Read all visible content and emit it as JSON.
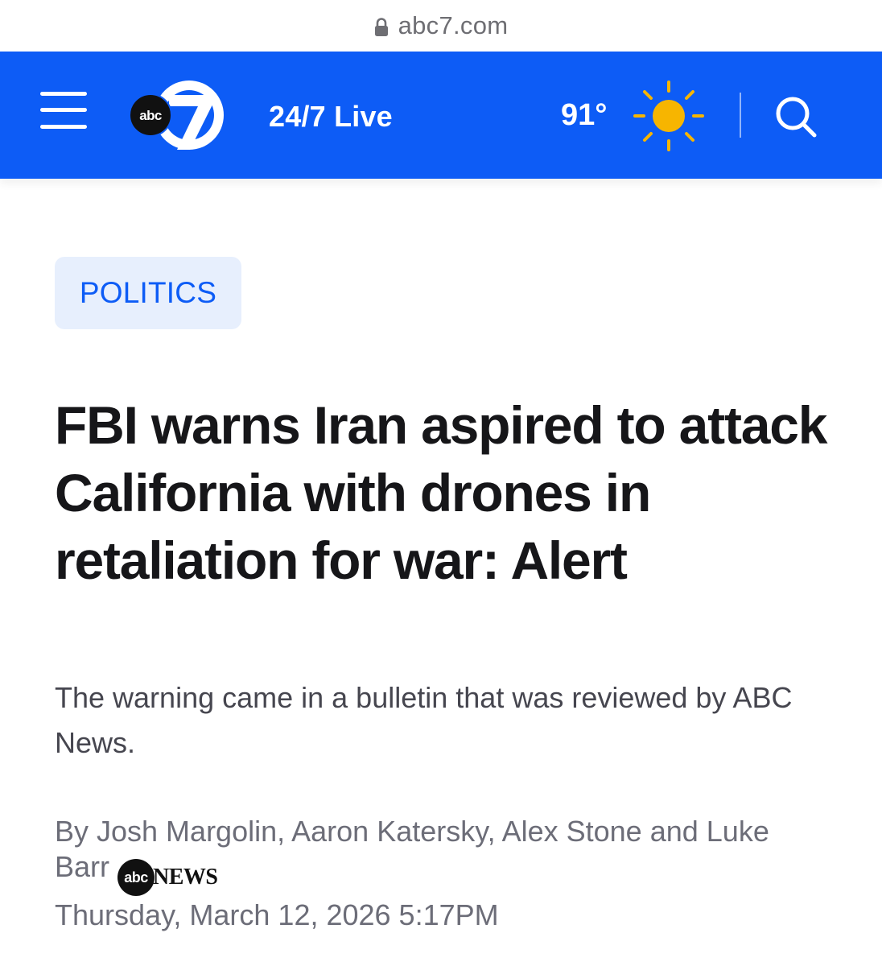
{
  "browser": {
    "url": "abc7.com",
    "lock_icon": "lock-icon"
  },
  "header": {
    "background_color": "#0d5cf6",
    "menu_icon": "hamburger-menu-icon",
    "logo": {
      "badge_text": "abc",
      "channel_number": "7"
    },
    "live_label": "24/7 Live",
    "weather": {
      "temperature": "91°",
      "icon": "sun-icon",
      "icon_color": "#f7b500"
    },
    "search_icon": "search-icon"
  },
  "article": {
    "category": "POLITICS",
    "headline": "FBI warns Iran aspired to attack California with drones in retaliation for war: Alert",
    "dek": "The warning came in a bulletin that was reviewed by ABC News.",
    "byline": "By Josh Margolin, Aaron Katersky, Alex Stone and Luke Barr",
    "source_logo": {
      "badge_text": "abc",
      "word": "NEWS"
    },
    "dateline": "Thursday, March 12, 2026 5:17PM"
  }
}
